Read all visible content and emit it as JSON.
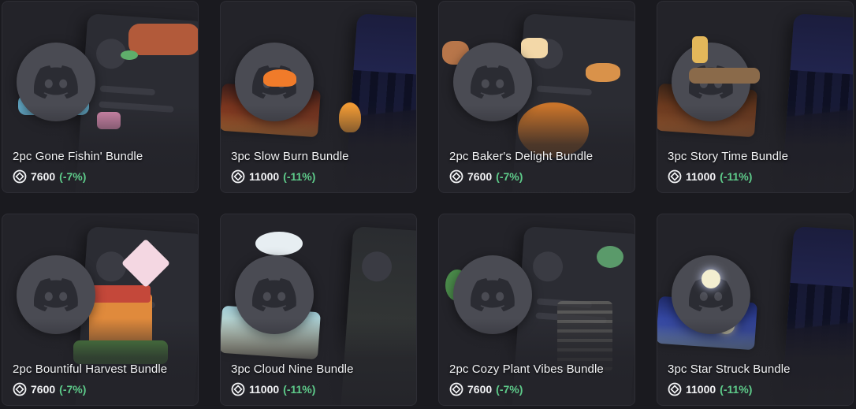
{
  "currency_icon": "orb-icon",
  "colors": {
    "discount": "#5ecb8a",
    "card_bg": "#232329",
    "page_bg": "#1a1a1f"
  },
  "bundles": [
    {
      "title": "2pc Gone Fishin' Bundle",
      "price": "7600",
      "discount": "(-7%)",
      "theme": "fishing"
    },
    {
      "title": "3pc Slow Burn Bundle",
      "price": "11000",
      "discount": "(-11%)",
      "theme": "campfire"
    },
    {
      "title": "2pc Baker's Delight Bundle",
      "price": "7600",
      "discount": "(-7%)",
      "theme": "bakery"
    },
    {
      "title": "3pc Story Time Bundle",
      "price": "11000",
      "discount": "(-11%)",
      "theme": "lantern"
    },
    {
      "title": "2pc Bountiful Harvest Bundle",
      "price": "7600",
      "discount": "(-7%)",
      "theme": "windmill"
    },
    {
      "title": "3pc Cloud Nine Bundle",
      "price": "11000",
      "discount": "(-11%)",
      "theme": "clouds"
    },
    {
      "title": "2pc Cozy Plant Vibes Bundle",
      "price": "7600",
      "discount": "(-7%)",
      "theme": "plants"
    },
    {
      "title": "3pc Star Struck Bundle",
      "price": "11000",
      "discount": "(-11%)",
      "theme": "night-sky"
    }
  ]
}
